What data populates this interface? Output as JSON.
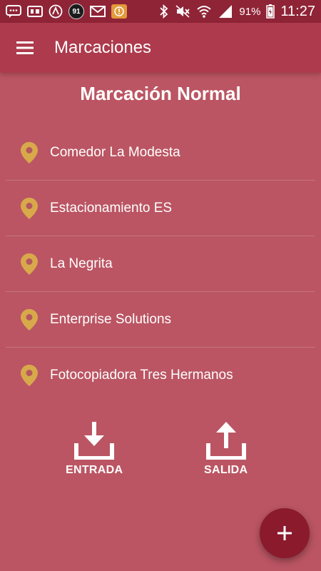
{
  "status_bar": {
    "notification_badge": "91",
    "battery": "91%",
    "time": "11:27"
  },
  "app_bar": {
    "title": "Marcaciones"
  },
  "section_title": "Marcación Normal",
  "locations": [
    {
      "label": "Comedor La Modesta"
    },
    {
      "label": "Estacionamiento ES"
    },
    {
      "label": "La Negrita"
    },
    {
      "label": "Enterprise Solutions"
    },
    {
      "label": "Fotocopiadora Tres Hermanos"
    }
  ],
  "actions": {
    "entrada_label": "ENTRADA",
    "salida_label": "SALIDA"
  },
  "colors": {
    "background": "#bb5563",
    "app_bar": "#ad3b4d",
    "status_bar": "#8f2436",
    "pin": "#d8a94a",
    "fab": "#8b1a2d"
  },
  "icons": {
    "menu": "hamburger-menu-icon",
    "location": "map-pin-icon",
    "entrada": "download-tray-icon",
    "salida": "upload-tray-icon",
    "fab": "plus-icon"
  }
}
